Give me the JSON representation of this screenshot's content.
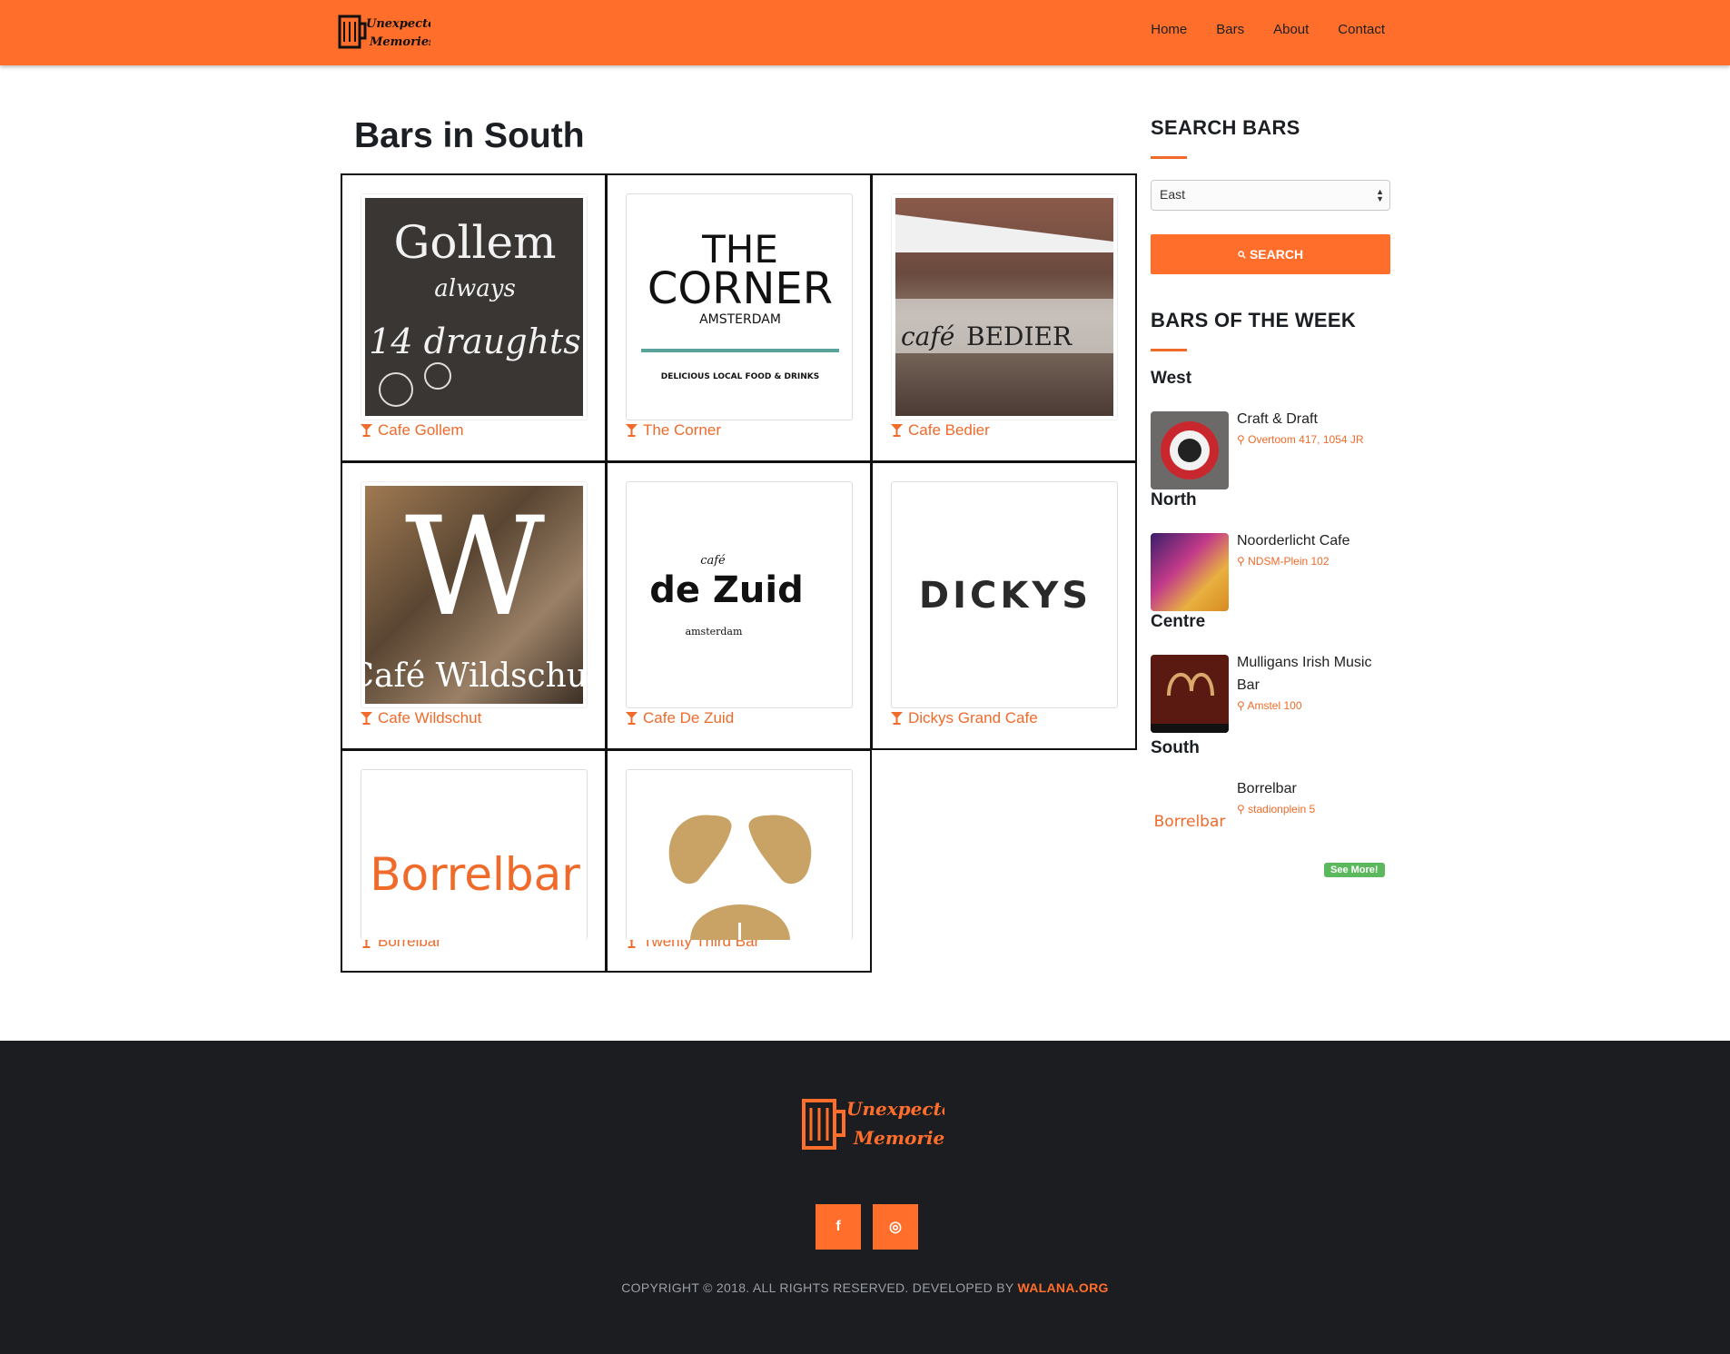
{
  "header": {
    "logo_line1": "Unexpected",
    "logo_line2": "Memories",
    "nav": [
      "Home",
      "Bars",
      "About",
      "Contact"
    ]
  },
  "main": {
    "title": "Bars in South",
    "bars": [
      {
        "name": "Cafe Gollem",
        "logo_text": [
          "Gollem",
          "always",
          "14 draughts"
        ]
      },
      {
        "name": "The Corner",
        "logo_text": [
          "THE",
          "CORNER",
          "AMSTERDAM",
          "DELICIOUS LOCAL FOOD & DRINKS"
        ]
      },
      {
        "name": "Cafe Bedier",
        "logo_text": [
          "café",
          "BEDIER"
        ]
      },
      {
        "name": "Cafe Wildschut",
        "logo_text": [
          "W",
          "Café Wildschut"
        ]
      },
      {
        "name": "Cafe De Zuid",
        "logo_text": [
          "café",
          "de Zuid",
          "amsterdam"
        ]
      },
      {
        "name": "Dickys Grand Cafe",
        "logo_text": [
          "DICKYS"
        ]
      },
      {
        "name": "Borrelbar",
        "logo_text": [
          "Borrelbar"
        ]
      },
      {
        "name": "Twenty Third Bar",
        "logo_text": []
      }
    ]
  },
  "sidebar": {
    "search_heading": "SEARCH BARS",
    "select_value": "East",
    "search_button": "SEARCH",
    "week_heading": "BARS OF THE WEEK",
    "week": [
      {
        "region": "West",
        "name": "Craft & Draft",
        "address": "Overtoom 417, 1054 JR"
      },
      {
        "region": "North",
        "name": "Noorderlicht Cafe",
        "address": "NDSM-Plein 102"
      },
      {
        "region": "Centre",
        "name": "Mulligans Irish Music Bar",
        "address": "Amstel 100"
      },
      {
        "region": "South",
        "name": "Borrelbar",
        "address": "stadionplein 5"
      }
    ],
    "see_more": "See More!"
  },
  "footer": {
    "logo_line1": "Unexpected",
    "logo_line2": "Memories",
    "social": [
      {
        "icon": "facebook-icon",
        "glyph": "f"
      },
      {
        "icon": "instagram-icon",
        "glyph": "◎"
      }
    ],
    "copyright": "COPYRIGHT © 2018. ALL RIGHTS RESERVED. DEVELOPED BY",
    "developer": "WALANA.ORG"
  },
  "colors": {
    "accent": "#ff6f2b",
    "footer_bg": "#1c1d21",
    "green": "#5cb85c"
  }
}
